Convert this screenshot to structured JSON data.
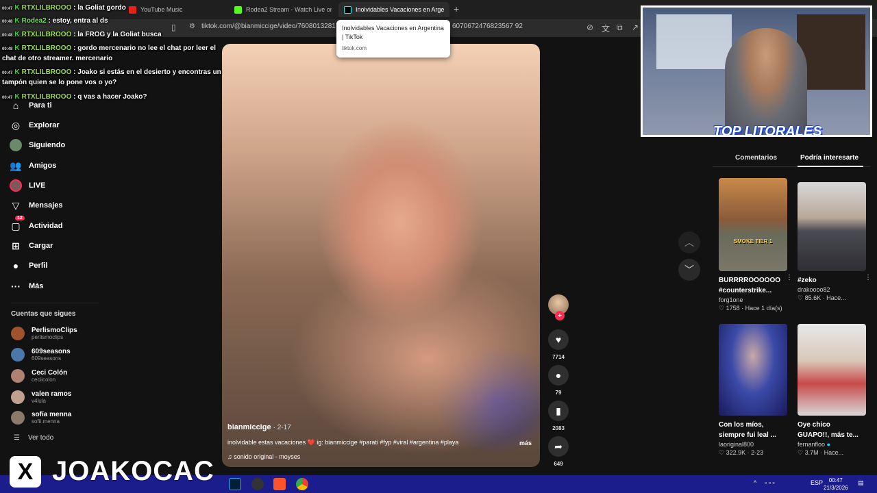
{
  "browser": {
    "tabs": [
      {
        "label": "YouTube Music"
      },
      {
        "label": "Rodea2 Stream - Watch Live on K"
      },
      {
        "label": "Inolvidables Vacaciones en Arge"
      }
    ],
    "new_tab": "+",
    "url": "tiktok.com/@bianmiccige/video/760801328173",
    "url_tail": "6070672476823567 92"
  },
  "tooltip": {
    "title": "Inolvidables Vacaciones en Argentina | TikTok",
    "domain": "tiktok.com"
  },
  "chat": [
    {
      "time": "00:47",
      "user": "RTXLILBROOO",
      "text": ": la Goliat gordo"
    },
    {
      "time": "00:48",
      "user": "Rodea2",
      "text": ": estoy, entra al ds"
    },
    {
      "time": "00:48",
      "user": "RTXLILBROOO",
      "text": ": la FROG y la Goliat busca"
    },
    {
      "time": "00:48",
      "user": "RTXLILBROOO",
      "text": ": gordo mercenario no lee el chat por leer el",
      "cont": "chat de otro streamer. mercenario"
    },
    {
      "time": "00:47",
      "user": "RTXLILBROOO",
      "text": ": Joako si estás en el desierto y encontras un",
      "cont": "tampón quien se lo pone vos o yo?"
    },
    {
      "time": "00:47",
      "user": "RTXLILBROOO",
      "text": ": q vas a hacer Joako?"
    }
  ],
  "nav": {
    "items": [
      {
        "label": "Para ti",
        "icon": "home-icon"
      },
      {
        "label": "Explorar",
        "icon": "compass-icon"
      },
      {
        "label": "Siguiendo",
        "icon": "following-avatar-icon"
      },
      {
        "label": "Amigos",
        "icon": "friends-icon"
      },
      {
        "label": "LIVE",
        "icon": "live-icon"
      },
      {
        "label": "Mensajes",
        "icon": "send-icon"
      },
      {
        "label": "Actividad",
        "icon": "activity-icon",
        "badge": "12"
      },
      {
        "label": "Cargar",
        "icon": "upload-icon"
      },
      {
        "label": "Perfil",
        "icon": "profile-icon"
      },
      {
        "label": "Más",
        "icon": "more-icon"
      }
    ],
    "following_title": "Cuentas que sigues",
    "following": [
      {
        "name": "PerlismoClips",
        "handle": "perlismoclips",
        "color": "#a0522d"
      },
      {
        "name": "609seasons",
        "handle": "609seasons",
        "color": "#4a78a8"
      },
      {
        "name": "Ceci Colón",
        "handle": "ceciicolon",
        "color": "#b08070"
      },
      {
        "name": "valen ramos",
        "handle": "v4lula",
        "color": "#c0a090"
      },
      {
        "name": "sofía menna",
        "handle": "sofii.menna",
        "color": "#8a7a6a"
      }
    ],
    "see_all": "Ver todo"
  },
  "video": {
    "author": "bianmiccige",
    "date": "· 2-17",
    "description": "inolvidable estas vacaciones ❤️ ig: bianmiccige #parati #fyp #viral #argentina #playa",
    "more": "más",
    "sound": "sonido original - moyses"
  },
  "actions": {
    "likes": "7714",
    "comments": "79",
    "saves": "2083",
    "shares": "649"
  },
  "right_panel": {
    "tabs": [
      "Comentarios",
      "Podría interesarte"
    ],
    "cards": [
      {
        "title": "BURRRROOOOOO #counterstrike...",
        "author": "forg1one",
        "likes": "1758",
        "time": "Hace 1 día(s)",
        "thumb_text": "SMOKE TIER 1"
      },
      {
        "title": "#zeko",
        "author": "drakoooo82",
        "likes": "85.6K",
        "time": "Hace..."
      },
      {
        "title": "Con los míos, siempre fui leal ...",
        "author": "laoriginal800",
        "likes": "322.9K",
        "time": "2-23"
      },
      {
        "title": "Oye chico GUAPO!!, más te...",
        "author": "fernanfloo",
        "likes": "3.7M",
        "time": "Hace..."
      }
    ]
  },
  "webcam": {
    "logo": "TOP LITORALES"
  },
  "streamer": {
    "logo": "X",
    "name": "JOAKOCAC"
  },
  "taskbar": {
    "lang": "ESP",
    "time": "00:47",
    "date": "21/3/2026"
  },
  "colors": {
    "accent": "#fe2c55",
    "taskbar": "#1c1d8c",
    "chat_badge": "#3dd13d"
  }
}
